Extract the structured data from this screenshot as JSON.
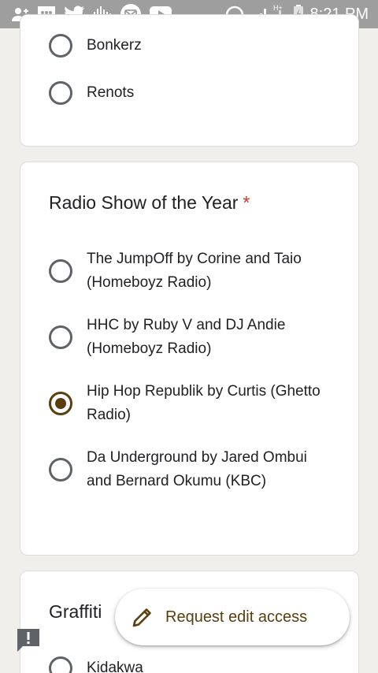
{
  "status_bar": {
    "time": "8:21 PM",
    "network_label": "H+",
    "icons": [
      "add-contact-icon",
      "sms-icon",
      "twitter-icon",
      "voice-icon",
      "mail-icon",
      "youtube-icon",
      "headphones-icon",
      "signal-icon",
      "battery-icon"
    ]
  },
  "previous_question": {
    "options": [
      {
        "label": "Bonkerz",
        "selected": false
      },
      {
        "label": "Renots",
        "selected": false
      }
    ]
  },
  "radio_show_question": {
    "title": "Radio Show of the Year",
    "required_marker": "*",
    "options": [
      {
        "label": "The JumpOff by Corine and Taio (Homeboyz Radio)",
        "selected": false
      },
      {
        "label": "HHC by Ruby V and DJ Andie (Homeboyz Radio)",
        "selected": false
      },
      {
        "label": "Hip Hop Republik by Curtis (Ghetto Radio)",
        "selected": true
      },
      {
        "label": "Da Underground by Jared Ombui and Bernard Okumu (KBC)",
        "selected": false
      }
    ]
  },
  "graffiti_question": {
    "title": "Graffiti",
    "options": [
      {
        "label": "Kidakwa",
        "selected": false
      }
    ]
  },
  "fab": {
    "label": "Request edit access",
    "icon": "pencil-icon"
  },
  "colors": {
    "accent": "#5a3e0e",
    "required": "#d93025",
    "status_bar": "#9e9e9e",
    "background": "#f1efec"
  }
}
